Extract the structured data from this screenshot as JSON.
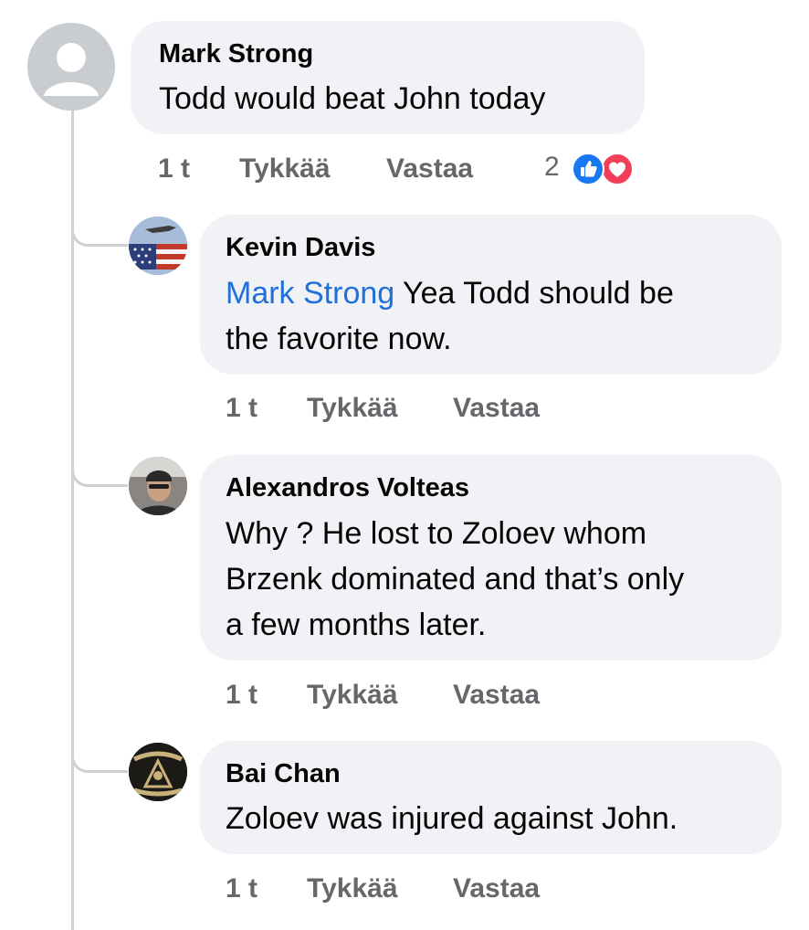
{
  "colors": {
    "bubble": "#f0f2f5",
    "mention": "#216fdb",
    "meta": "#65676b",
    "like_blue": "#1877f2",
    "love_red": "#f33e58",
    "thread_line": "#ced0d4"
  },
  "comments": [
    {
      "author": "Mark Strong",
      "lines": [
        "Todd would beat John today"
      ],
      "time": "1 t",
      "like_label": "Tykkää",
      "reply_label": "Vastaa",
      "reaction_count": "2",
      "reactions": [
        "like-icon",
        "love-icon"
      ],
      "avatar": "default-avatar"
    },
    {
      "author": "Kevin Davis",
      "mention": "Mark Strong",
      "lines": [
        " Yea Todd should be",
        "the favorite now."
      ],
      "time": "1 t",
      "like_label": "Tykkää",
      "reply_label": "Vastaa",
      "avatar": "flag-avatar"
    },
    {
      "author": "Alexandros Volteas",
      "lines": [
        "Why ? He lost to Zoloev whom",
        "Brzenk dominated and that’s only",
        "a few months later."
      ],
      "time": "1 t",
      "like_label": "Tykkää",
      "reply_label": "Vastaa",
      "avatar": "photo-avatar"
    },
    {
      "author": "Bai Chan",
      "lines": [
        "Zoloev was injured against John."
      ],
      "time": "1 t",
      "like_label": "Tykkää",
      "reply_label": "Vastaa",
      "avatar": "logo-avatar"
    }
  ]
}
